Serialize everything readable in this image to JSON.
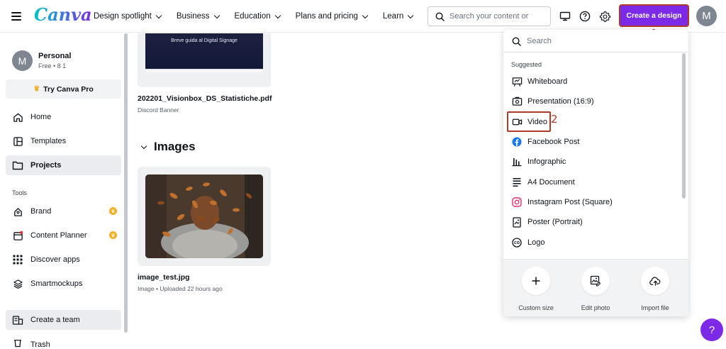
{
  "brand": {
    "logo_text": "Canva",
    "accent": "#7d2ae8",
    "annotation_color": "#b1392a"
  },
  "header": {
    "nav": [
      {
        "label": "Design spotlight"
      },
      {
        "label": "Business"
      },
      {
        "label": "Education"
      },
      {
        "label": "Plans and pricing"
      },
      {
        "label": "Learn"
      }
    ],
    "search_placeholder": "Search your content or",
    "create_label": "Create a design",
    "avatar_initial": "M",
    "annotation_1": "1"
  },
  "sidebar": {
    "account_name": "Personal",
    "account_sub": "Free • 8 1",
    "avatar_initial": "M",
    "try_pro": "Try Canva Pro",
    "items": [
      {
        "label": "Home",
        "icon": "home-icon"
      },
      {
        "label": "Templates",
        "icon": "templates-icon"
      },
      {
        "label": "Projects",
        "icon": "folder-icon",
        "active": true
      }
    ],
    "tools_label": "Tools",
    "tools": [
      {
        "label": "Brand",
        "icon": "brand-icon",
        "pro": true
      },
      {
        "label": "Content Planner",
        "icon": "calendar-icon",
        "pro": true
      },
      {
        "label": "Discover apps",
        "icon": "apps-grid-icon"
      },
      {
        "label": "Smartmockups",
        "icon": "layers-icon"
      }
    ],
    "create_team": "Create a team",
    "trash": "Trash"
  },
  "main": {
    "file1": {
      "thumb_text": "Breve guida al Digital Signage",
      "name": "202201_Visionbox_DS_Statistiche.pdf",
      "sub": "Discord Banner"
    },
    "section_title": "Images",
    "file2": {
      "name": "image_test.jpg",
      "sub": "Image • Uploaded 22 hours ago"
    }
  },
  "panel": {
    "search_placeholder": "Search",
    "suggested_label": "Suggested",
    "items": [
      {
        "label": "Whiteboard",
        "icon": "whiteboard-icon"
      },
      {
        "label": "Presentation (16:9)",
        "icon": "presentation-icon"
      },
      {
        "label": "Video",
        "icon": "video-icon",
        "highlight": true
      },
      {
        "label": "Facebook Post",
        "icon": "facebook-icon"
      },
      {
        "label": "Infographic",
        "icon": "infographic-icon"
      },
      {
        "label": "A4 Document",
        "icon": "document-icon"
      },
      {
        "label": "Instagram Post (Square)",
        "icon": "instagram-icon"
      },
      {
        "label": "Poster (Portrait)",
        "icon": "poster-icon"
      },
      {
        "label": "Logo",
        "icon": "logo-icon"
      }
    ],
    "annotation_2": "2",
    "actions": [
      {
        "label": "Custom size",
        "icon": "plus-icon"
      },
      {
        "label": "Edit photo",
        "icon": "edit-photo-icon"
      },
      {
        "label": "Import file",
        "icon": "upload-cloud-icon"
      }
    ]
  },
  "help_label": "?"
}
